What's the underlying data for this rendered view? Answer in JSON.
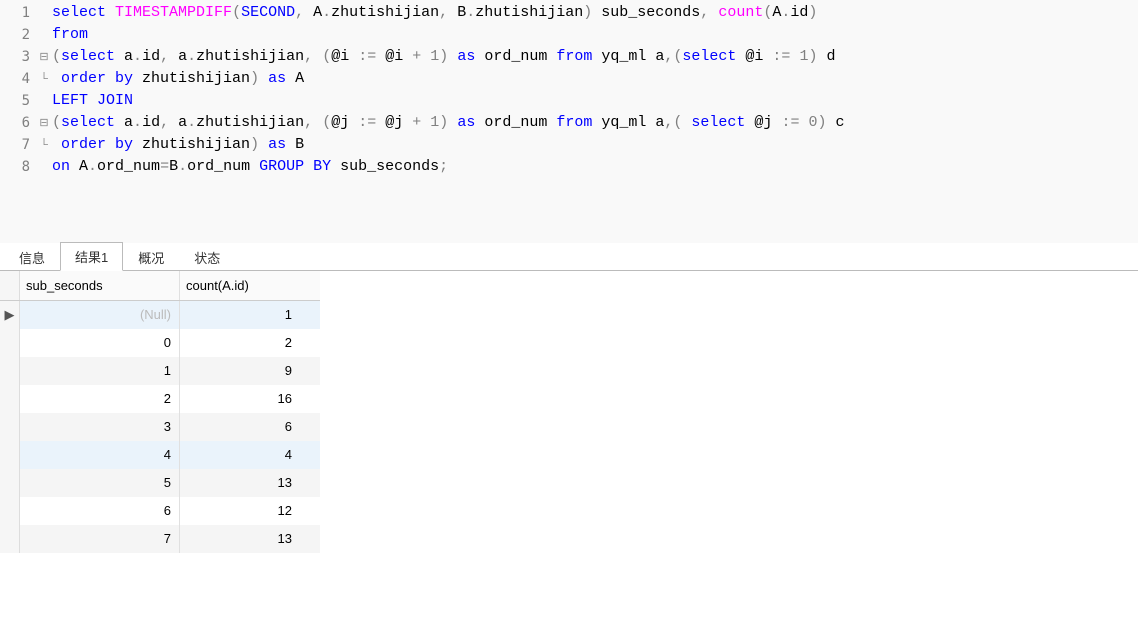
{
  "editor": {
    "lines": [
      {
        "num": "1",
        "fold": "",
        "parts": [
          {
            "c": "kw",
            "t": "select"
          },
          {
            "c": "tx",
            "t": " "
          },
          {
            "c": "fn",
            "t": "TIMESTAMPDIFF"
          },
          {
            "c": "op",
            "t": "("
          },
          {
            "c": "kw",
            "t": "SECOND"
          },
          {
            "c": "op",
            "t": ","
          },
          {
            "c": "tx",
            "t": " A"
          },
          {
            "c": "op",
            "t": "."
          },
          {
            "c": "tx",
            "t": "zhutishijian"
          },
          {
            "c": "op",
            "t": ","
          },
          {
            "c": "tx",
            "t": " B"
          },
          {
            "c": "op",
            "t": "."
          },
          {
            "c": "tx",
            "t": "zhutishijian"
          },
          {
            "c": "op",
            "t": ")"
          },
          {
            "c": "tx",
            "t": " sub_seconds"
          },
          {
            "c": "op",
            "t": ","
          },
          {
            "c": "tx",
            "t": " "
          },
          {
            "c": "fn",
            "t": "count"
          },
          {
            "c": "op",
            "t": "("
          },
          {
            "c": "tx",
            "t": "A"
          },
          {
            "c": "op",
            "t": "."
          },
          {
            "c": "tx",
            "t": "id"
          },
          {
            "c": "op",
            "t": ")"
          }
        ]
      },
      {
        "num": "2",
        "fold": "",
        "parts": [
          {
            "c": "kw",
            "t": "from"
          }
        ]
      },
      {
        "num": "3",
        "fold": "⊟",
        "parts": [
          {
            "c": "op",
            "t": "("
          },
          {
            "c": "kw",
            "t": "select"
          },
          {
            "c": "tx",
            "t": " a"
          },
          {
            "c": "op",
            "t": "."
          },
          {
            "c": "tx",
            "t": "id"
          },
          {
            "c": "op",
            "t": ","
          },
          {
            "c": "tx",
            "t": " a"
          },
          {
            "c": "op",
            "t": "."
          },
          {
            "c": "tx",
            "t": "zhutishijian"
          },
          {
            "c": "op",
            "t": ","
          },
          {
            "c": "tx",
            "t": " "
          },
          {
            "c": "op",
            "t": "("
          },
          {
            "c": "tx",
            "t": "@i "
          },
          {
            "c": "op",
            "t": ":="
          },
          {
            "c": "tx",
            "t": " @i "
          },
          {
            "c": "op",
            "t": "+"
          },
          {
            "c": "tx",
            "t": " "
          },
          {
            "c": "op",
            "t": "1)"
          },
          {
            "c": "tx",
            "t": " "
          },
          {
            "c": "kw",
            "t": "as"
          },
          {
            "c": "tx",
            "t": " ord_num "
          },
          {
            "c": "kw",
            "t": "from"
          },
          {
            "c": "tx",
            "t": " yq_ml a"
          },
          {
            "c": "op",
            "t": ",("
          },
          {
            "c": "kw",
            "t": "select"
          },
          {
            "c": "tx",
            "t": " @i "
          },
          {
            "c": "op",
            "t": ":="
          },
          {
            "c": "tx",
            "t": " "
          },
          {
            "c": "op",
            "t": "1)"
          },
          {
            "c": "tx",
            "t": " d"
          }
        ]
      },
      {
        "num": "4",
        "fold": "└",
        "parts": [
          {
            "c": "tx",
            "t": " "
          },
          {
            "c": "kw",
            "t": "order by"
          },
          {
            "c": "tx",
            "t": " zhutishijian"
          },
          {
            "c": "op",
            "t": ")"
          },
          {
            "c": "tx",
            "t": " "
          },
          {
            "c": "kw",
            "t": "as"
          },
          {
            "c": "tx",
            "t": " A"
          }
        ]
      },
      {
        "num": "5",
        "fold": "",
        "parts": [
          {
            "c": "kw",
            "t": "LEFT JOIN"
          }
        ]
      },
      {
        "num": "6",
        "fold": "⊟",
        "parts": [
          {
            "c": "op",
            "t": "("
          },
          {
            "c": "kw",
            "t": "select"
          },
          {
            "c": "tx",
            "t": " a"
          },
          {
            "c": "op",
            "t": "."
          },
          {
            "c": "tx",
            "t": "id"
          },
          {
            "c": "op",
            "t": ","
          },
          {
            "c": "tx",
            "t": " a"
          },
          {
            "c": "op",
            "t": "."
          },
          {
            "c": "tx",
            "t": "zhutishijian"
          },
          {
            "c": "op",
            "t": ","
          },
          {
            "c": "tx",
            "t": " "
          },
          {
            "c": "op",
            "t": "("
          },
          {
            "c": "tx",
            "t": "@j "
          },
          {
            "c": "op",
            "t": ":="
          },
          {
            "c": "tx",
            "t": " @j "
          },
          {
            "c": "op",
            "t": "+"
          },
          {
            "c": "tx",
            "t": " "
          },
          {
            "c": "op",
            "t": "1)"
          },
          {
            "c": "tx",
            "t": " "
          },
          {
            "c": "kw",
            "t": "as"
          },
          {
            "c": "tx",
            "t": " ord_num "
          },
          {
            "c": "kw",
            "t": "from"
          },
          {
            "c": "tx",
            "t": " yq_ml a"
          },
          {
            "c": "op",
            "t": ",("
          },
          {
            "c": "tx",
            "t": " "
          },
          {
            "c": "kw",
            "t": "select"
          },
          {
            "c": "tx",
            "t": " @j "
          },
          {
            "c": "op",
            "t": ":="
          },
          {
            "c": "tx",
            "t": " "
          },
          {
            "c": "op",
            "t": "0)"
          },
          {
            "c": "tx",
            "t": " c"
          }
        ]
      },
      {
        "num": "7",
        "fold": "└",
        "parts": [
          {
            "c": "tx",
            "t": " "
          },
          {
            "c": "kw",
            "t": "order by"
          },
          {
            "c": "tx",
            "t": " zhutishijian"
          },
          {
            "c": "op",
            "t": ")"
          },
          {
            "c": "tx",
            "t": " "
          },
          {
            "c": "kw",
            "t": "as"
          },
          {
            "c": "tx",
            "t": " B"
          }
        ]
      },
      {
        "num": "8",
        "fold": "",
        "parts": [
          {
            "c": "kw",
            "t": "on"
          },
          {
            "c": "tx",
            "t": " A"
          },
          {
            "c": "op",
            "t": "."
          },
          {
            "c": "tx",
            "t": "ord_num"
          },
          {
            "c": "op",
            "t": "="
          },
          {
            "c": "tx",
            "t": "B"
          },
          {
            "c": "op",
            "t": "."
          },
          {
            "c": "tx",
            "t": "ord_num "
          },
          {
            "c": "kw",
            "t": "GROUP BY"
          },
          {
            "c": "tx",
            "t": " sub_seconds"
          },
          {
            "c": "op",
            "t": ";"
          }
        ]
      }
    ]
  },
  "tabs": {
    "items": [
      {
        "label": "信息",
        "active": false
      },
      {
        "label": "结果1",
        "active": true
      },
      {
        "label": "概况",
        "active": false
      },
      {
        "label": "状态",
        "active": false
      }
    ]
  },
  "grid": {
    "headers": [
      "sub_seconds",
      "count(A.id)"
    ],
    "null_text": "(Null)",
    "rows": [
      {
        "c1": null,
        "c2": "1",
        "mark": "▶",
        "sel": true
      },
      {
        "c1": "0",
        "c2": "2"
      },
      {
        "c1": "1",
        "c2": "9",
        "alt": true
      },
      {
        "c1": "2",
        "c2": "16"
      },
      {
        "c1": "3",
        "c2": "6",
        "alt": true
      },
      {
        "c1": "4",
        "c2": "4",
        "sel": true
      },
      {
        "c1": "5",
        "c2": "13",
        "alt": true
      },
      {
        "c1": "6",
        "c2": "12"
      },
      {
        "c1": "7",
        "c2": "13",
        "alt": true
      }
    ]
  }
}
